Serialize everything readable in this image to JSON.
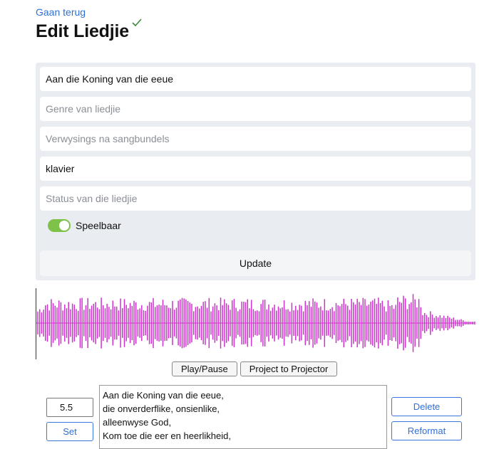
{
  "nav": {
    "back_label": "Gaan terug"
  },
  "header": {
    "title": "Edit Liedjie",
    "saved_icon": "checkmark-icon"
  },
  "form": {
    "title_value": "Aan die Koning van die eeue",
    "genre_placeholder": "Genre van liedjie",
    "references_placeholder": "Verwysings na sangbundels",
    "instrument_value": "klavier",
    "status_placeholder": "Status van die liedjie",
    "playable_label": "Speelbaar",
    "playable_on": true,
    "update_label": "Update"
  },
  "player": {
    "play_pause_label": "Play/Pause",
    "project_label": "Project to Projector",
    "waveform_color": "#cc33cc"
  },
  "lyrics_editor": {
    "time_value": "5.5",
    "set_label": "Set",
    "delete_label": "Delete",
    "reformat_label": "Reformat",
    "text": "Aan die Koning van die eeue,\ndie onverderflike, onsienlike,\nalleenwyse God,\nKom toe die eer en heerlikheid,"
  },
  "colors": {
    "link": "#2f6fd6",
    "toggle_on": "#7fc24a",
    "panel_bg": "#e9ecf0"
  }
}
